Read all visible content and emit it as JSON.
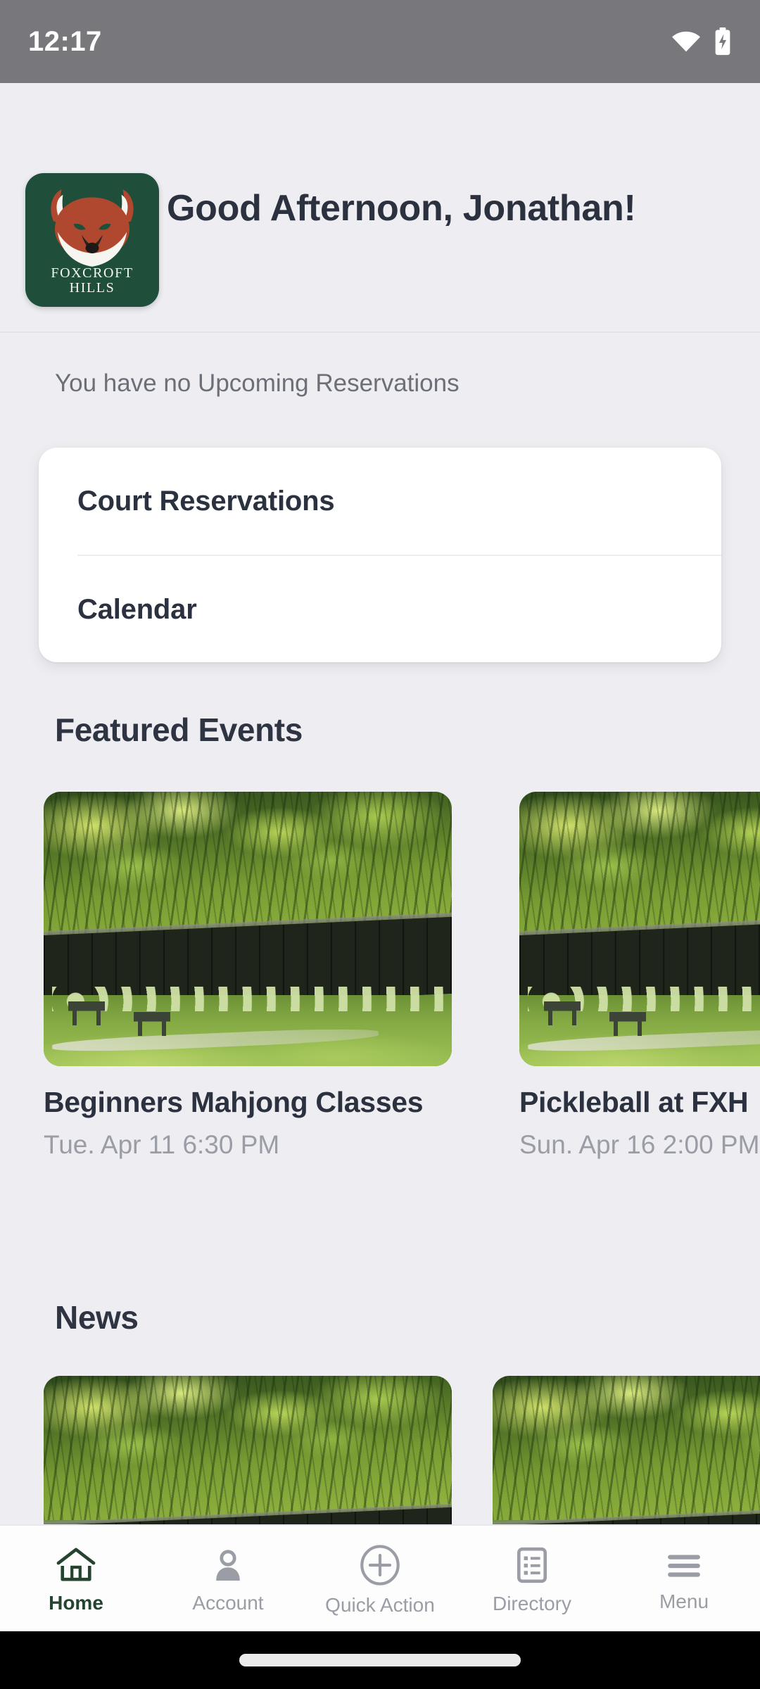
{
  "status_bar": {
    "clock": "12:17",
    "wifi_icon": "wifi-icon",
    "battery_icon": "battery-charging-icon",
    "background_color": "#78787c"
  },
  "header": {
    "logo": {
      "icon_name": "fox-head-logo-icon",
      "brand_line_1": "FOXCROFT",
      "brand_line_2": "HILLS",
      "background_color": "#1f4f3a",
      "fox_color": "#b0482f"
    },
    "greeting": "Good Afternoon, Jonathan!"
  },
  "reservations": {
    "empty_message": "You have no Upcoming Reservations",
    "quick_links": [
      {
        "label": "Court Reservations"
      },
      {
        "label": "Calendar"
      }
    ]
  },
  "featured_events": {
    "title": "Featured Events",
    "cards": [
      {
        "title": "Beginners Mahjong Classes",
        "datetime": "Tue. Apr 11 6:30 PM",
        "image_name": "tennis-courts-photo"
      },
      {
        "title": "Pickleball at FXH",
        "datetime": "Sun. Apr 16 2:00 PM",
        "image_name": "tennis-courts-photo"
      }
    ]
  },
  "news": {
    "title": "News",
    "cards": [
      {
        "image_name": "tree-canopy-photo"
      },
      {
        "image_name": "tree-canopy-photo"
      }
    ]
  },
  "bottom_nav": {
    "active_color": "#24442f",
    "inactive_color": "#9a9da6",
    "items": [
      {
        "label": "Home",
        "icon": "home-icon"
      },
      {
        "label": "Account",
        "icon": "person-icon"
      },
      {
        "label": "Quick Action",
        "icon": "plus-circle-icon"
      },
      {
        "label": "Directory",
        "icon": "list-document-icon"
      },
      {
        "label": "Menu",
        "icon": "hamburger-menu-icon"
      }
    ]
  }
}
